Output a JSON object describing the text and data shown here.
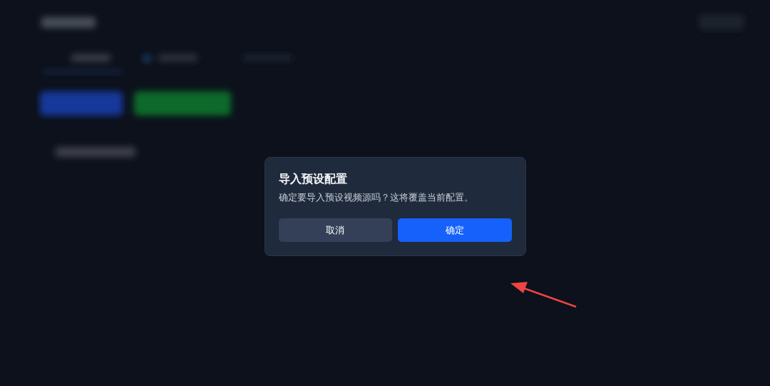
{
  "dialog": {
    "title": "导入预设配置",
    "message": "确定要导入预设视频源吗？这将覆盖当前配置。",
    "buttons": [
      {
        "label": "取消",
        "kind": "secondary"
      },
      {
        "label": "确定",
        "kind": "primary"
      }
    ]
  }
}
